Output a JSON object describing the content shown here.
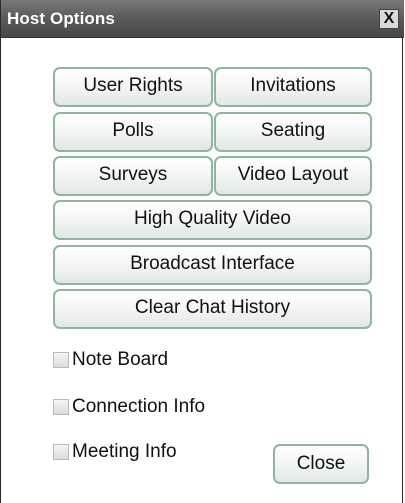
{
  "window": {
    "title": "Host Options",
    "close_glyph": "X"
  },
  "buttons": {
    "user_rights": "User Rights",
    "invitations": "Invitations",
    "polls": "Polls",
    "seating": "Seating",
    "surveys": "Surveys",
    "video_layout": "Video Layout",
    "high_quality_video": "High Quality Video",
    "broadcast_interface": "Broadcast Interface",
    "clear_chat_history": "Clear Chat History",
    "close": "Close"
  },
  "checkboxes": {
    "note_board": {
      "label": "Note Board",
      "checked": false
    },
    "connection_info": {
      "label": "Connection Info",
      "checked": false
    },
    "meeting_info": {
      "label": "Meeting Info",
      "checked": false
    }
  },
  "colors": {
    "titlebar": "#5c5c5c",
    "button_border": "#8fb59c"
  }
}
